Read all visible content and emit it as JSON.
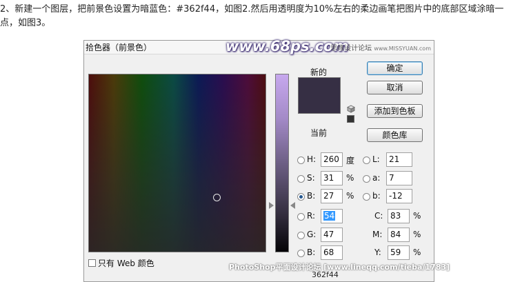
{
  "intro": {
    "text": "2、新建一个图层，把前景色设置为暗蓝色：#362f44，如图2.然后用透明度为10%左右的柔边画笔把图片中的底部区域涂暗一点，如图3。"
  },
  "dialog": {
    "title": "拾色器（前景色）",
    "watermark_site": "www.68ps.com",
    "watermark_forum": "思缘设计论坛",
    "watermark_forum_url": "www.MISSYUAN.com",
    "label_new": "新的",
    "label_current": "当前",
    "new_color": "#362f44",
    "buttons": {
      "ok": "确定",
      "cancel": "取消",
      "add_swatch": "添加到色板",
      "color_library": "颜色库"
    },
    "fields": {
      "h": {
        "label": "H:",
        "value": "260",
        "unit": "度"
      },
      "s": {
        "label": "S:",
        "value": "31",
        "unit": "%"
      },
      "b": {
        "label": "B:",
        "value": "27",
        "unit": "%"
      },
      "r": {
        "label": "R:",
        "value": "54"
      },
      "g": {
        "label": "G:",
        "value": "47"
      },
      "bl": {
        "label": "B:",
        "value": "68"
      },
      "l": {
        "label": "L:",
        "value": "21"
      },
      "a": {
        "label": "a:",
        "value": "7"
      },
      "lab_b": {
        "label": "b:",
        "value": "-12"
      },
      "c": {
        "label": "C:",
        "value": "83",
        "unit": "%"
      },
      "m": {
        "label": "M:",
        "value": "84",
        "unit": "%"
      },
      "y": {
        "label": "Y:",
        "value": "59",
        "unit": "%"
      }
    },
    "web_only_label": "只有 Web 颜色",
    "hex_partial": "362f44",
    "watermark_bottom": "PhotoShop平面设计论坛 [www.lineqq.com/tieba/1783]"
  }
}
